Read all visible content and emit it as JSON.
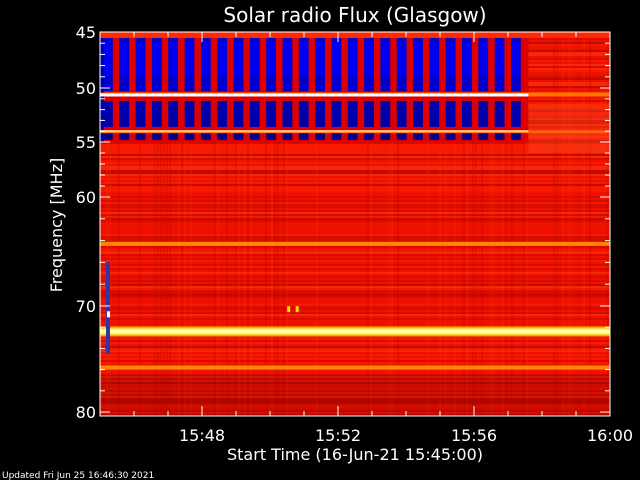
{
  "chart_data": {
    "type": "heatmap",
    "title": "Solar radio Flux (Glasgow)",
    "xlabel": "Start Time (16-Jun-21 15:45:00)",
    "ylabel": "Frequency [MHz]",
    "x_ticks": [
      "15:48",
      "15:52",
      "15:56",
      "16:00"
    ],
    "x_tick_minutes": [
      3,
      7,
      11,
      15
    ],
    "x_range_minutes": [
      0,
      15
    ],
    "y_ticks": [
      "45",
      "50",
      "55",
      "60",
      "70",
      "80"
    ],
    "y_tick_values": [
      45,
      50,
      55,
      60,
      70,
      80
    ],
    "ylim": [
      45,
      80
    ],
    "y_reversed": true,
    "background_color": "#ee1100",
    "color_scale": [
      "#000088",
      "#0000ff",
      "#ff0000",
      "#ffff00",
      "#ffffff"
    ],
    "pulsed_band_mhz": [
      45.5,
      55
    ],
    "pulsed_until_minute": 12.6,
    "pulse_period_minutes": 0.48,
    "bright_lines_mhz": [
      50.6,
      54.0,
      64.3,
      72.4,
      75.8
    ],
    "hot_spots": [
      {
        "minute": 5.55,
        "mhz": 70.3
      },
      {
        "minute": 5.8,
        "mhz": 70.3
      }
    ]
  },
  "footer": {
    "updated": "Updated Fri Jun 25 16:46:30 2021"
  }
}
